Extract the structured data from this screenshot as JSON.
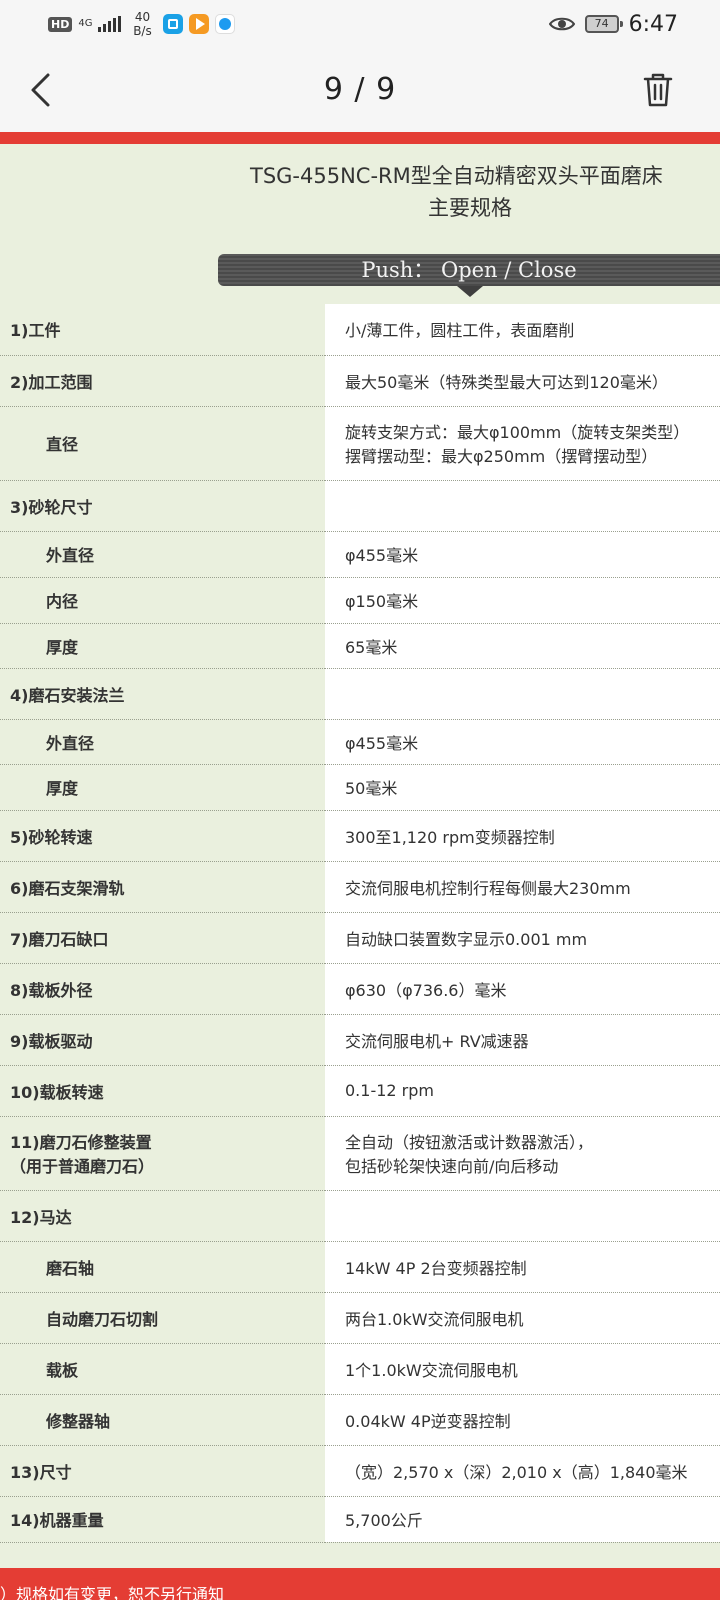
{
  "status_bar": {
    "hd": "HD",
    "network": "4G",
    "speed_value": "40",
    "speed_unit": "B/s",
    "battery": "74",
    "time": "6:47",
    "icons": [
      "app-icon-blue",
      "app-icon-orange",
      "app-icon-round",
      "eye-icon",
      "battery-icon"
    ]
  },
  "top_bar": {
    "title": "9 / 9",
    "back_icon": "chevron-left-icon",
    "delete_icon": "trash-icon"
  },
  "image": {
    "title_line1": "TSG-455NC-RM型全自动精密双头平面磨床",
    "title_line2": "主要规格",
    "toggle_label": "Push： Open / Close",
    "specs": [
      {
        "label": "1)工件",
        "value": "小/薄工件，圆柱工件，表面磨削",
        "sub": false
      },
      {
        "label": "2)加工范围",
        "value": "最大50毫米（特殊类型最大可达到120毫米）",
        "sub": false
      },
      {
        "label": "直径",
        "value": "旋转支架方式：最大φ100mm（旋转支架类型）",
        "value2": "摆臂摆动型：最大φ250mm（摆臂摆动型）",
        "sub": true
      },
      {
        "label": "3)砂轮尺寸",
        "value": "",
        "sub": false
      },
      {
        "label": "外直径",
        "value": "φ455毫米",
        "sub": true
      },
      {
        "label": "内径",
        "value": "φ150毫米",
        "sub": true
      },
      {
        "label": "厚度",
        "value": "65毫米",
        "sub": true
      },
      {
        "label": "4)磨石安装法兰",
        "value": "",
        "sub": false
      },
      {
        "label": "外直径",
        "value": "φ455毫米",
        "sub": true
      },
      {
        "label": "厚度",
        "value": "50毫米",
        "sub": true
      },
      {
        "label": "5)砂轮转速",
        "value": "300至1,120 rpm变频器控制",
        "sub": false
      },
      {
        "label": "6)磨石支架滑轨",
        "value": "交流伺服电机控制行程每侧最大230mm",
        "sub": false
      },
      {
        "label": "7)磨刀石缺口",
        "value": "自动缺口装置数字显示0.001 mm",
        "sub": false
      },
      {
        "label": "8)载板外径",
        "value": "φ630（φ736.6）毫米",
        "sub": false
      },
      {
        "label": "9)载板驱动",
        "value": "交流伺服电机+ RV减速器",
        "sub": false
      },
      {
        "label": "10)载板转速",
        "value": "0.1-12 rpm",
        "sub": false
      },
      {
        "label": "11)磨刀石修整装置",
        "label2": "（用于普通磨刀石）",
        "value": "全自动（按钮激活或计数器激活），",
        "value2": "包括砂轮架快速向前/向后移动",
        "sub": false
      },
      {
        "label": "12)马达",
        "value": "",
        "sub": false
      },
      {
        "label": "磨石轴",
        "value": "14kW 4P 2台变频器控制",
        "sub": true
      },
      {
        "label": "自动磨刀石切割",
        "value": "两台1.0kW交流伺服电机",
        "sub": true
      },
      {
        "label": "载板",
        "value": "1个1.0kW交流伺服电机",
        "sub": true
      },
      {
        "label": "修整器轴",
        "value": "0.04kW 4P逆变器控制",
        "sub": true
      },
      {
        "label": "13)尺寸",
        "value": "（宽）2,570 x（深）2,010 x（高）1,840毫米",
        "sub": false
      },
      {
        "label": "14)机器重量",
        "value": "5,700公斤",
        "sub": false
      }
    ],
    "footer_note": "）规格如有变更，恕不另行通知"
  }
}
